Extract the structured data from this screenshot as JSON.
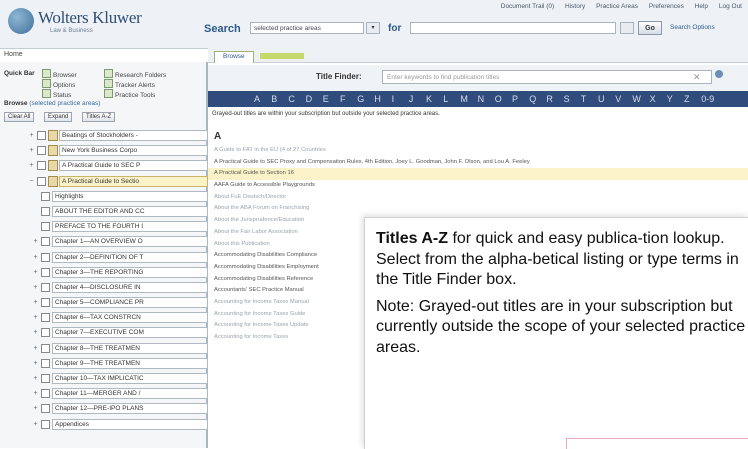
{
  "header": {
    "logo_name": "Wolters Kluwer",
    "logo_sub": "Law & Business",
    "top_links": [
      "Document Trail (0)",
      "History",
      "Practice Areas",
      "Preferences",
      "Help",
      "Log Out"
    ],
    "search_label": "Search",
    "search_scope_value": "selected practice areas",
    "for_label": "for",
    "for_value": "",
    "go_label": "Go",
    "search_options_label": "Search Options"
  },
  "home_link": "Home",
  "quick_bar": {
    "label": "Quick Bar",
    "items": [
      "Browser",
      "Research Folders",
      "Options",
      "Tracker Alerts",
      "Status",
      "Practice Tools"
    ]
  },
  "browse": {
    "label": "Browse",
    "hint": "(selected practice areas)",
    "tools": [
      "Clear All",
      "Expand",
      "Titles A-Z"
    ]
  },
  "tree": [
    {
      "label": "Beatings of Stockholders -",
      "level": 0,
      "expand": "+",
      "selected": false
    },
    {
      "label": "New York Business Corpo",
      "level": 0,
      "expand": "+",
      "selected": false
    },
    {
      "label": "A Practical Guide to SEC P",
      "level": 0,
      "expand": "+",
      "selected": false
    },
    {
      "label": "A Practical Guide to Sectio",
      "level": 0,
      "expand": "−",
      "selected": true
    },
    {
      "label": "Highlights",
      "level": 1,
      "expand": "",
      "selected": false
    },
    {
      "label": "ABOUT THE EDITOR AND CC",
      "level": 1,
      "expand": "",
      "selected": false
    },
    {
      "label": "PREFACE TO THE FOURTH I",
      "level": 1,
      "expand": "",
      "selected": false
    },
    {
      "label": "Chapter 1—AN OVERVIEW O",
      "level": 1,
      "expand": "+",
      "selected": false
    },
    {
      "label": "Chapter 2—DEFINITION OF T",
      "level": 1,
      "expand": "+",
      "selected": false
    },
    {
      "label": "Chapter 3—THE REPORTING",
      "level": 1,
      "expand": "+",
      "selected": false
    },
    {
      "label": "Chapter 4—DISCLOSURE IN",
      "level": 1,
      "expand": "+",
      "selected": false
    },
    {
      "label": "Chapter 5—COMPLIANCE PR",
      "level": 1,
      "expand": "+",
      "selected": false
    },
    {
      "label": "Chapter 6—TAX CONSTRCN",
      "level": 1,
      "expand": "+",
      "selected": false
    },
    {
      "label": "Chapter 7—EXECUTIVE COM",
      "level": 1,
      "expand": "+",
      "selected": false
    },
    {
      "label": "Chapter 8—THE TREATMEN",
      "level": 1,
      "expand": "+",
      "selected": false
    },
    {
      "label": "Chapter 9—THE TREATMEN",
      "level": 1,
      "expand": "+",
      "selected": false
    },
    {
      "label": "Chapter 10—TAX IMPLICATIC",
      "level": 1,
      "expand": "+",
      "selected": false
    },
    {
      "label": "Chapter 11—MERGER AND /",
      "level": 1,
      "expand": "+",
      "selected": false
    },
    {
      "label": "Chapter 12—PRE-IPO PLANS",
      "level": 1,
      "expand": "+",
      "selected": false
    },
    {
      "label": "Appendices",
      "level": 1,
      "expand": "+",
      "selected": false
    }
  ],
  "right": {
    "tab_label": "Browse",
    "title_finder_label": "Title Finder:",
    "title_finder_placeholder": "Enter keywords to find publication titles",
    "alphabet": [
      "A",
      "B",
      "C",
      "D",
      "E",
      "F",
      "G",
      "H",
      "I",
      "J",
      "K",
      "L",
      "M",
      "N",
      "O",
      "P",
      "Q",
      "R",
      "S",
      "T",
      "U",
      "V",
      "W",
      "X",
      "Y",
      "Z",
      "0-9"
    ],
    "notice": "Grayed-out titles are within your subscription but outside your selected practice areas.",
    "section": "A",
    "titles": [
      {
        "text": "A Guide to FAT in the EU (4 of 27 Countries",
        "gray": true,
        "hl": false
      },
      {
        "text": "A Practical Guide to SEC Proxy and Compensation Rules, 4th Edition, Joey L. Goodman, John F. Olson, and Lou A. Feeley",
        "gray": false,
        "hl": false
      },
      {
        "text": "A Practical Guide to Section 16",
        "gray": false,
        "hl": true
      },
      {
        "text": "AAFA Guide to Accessible Playgrounds",
        "gray": false,
        "hl": false
      },
      {
        "text": "About FuE Deutsch/Director",
        "gray": true,
        "hl": false
      },
      {
        "text": "About the ABA Forum on Franchising",
        "gray": true,
        "hl": false
      },
      {
        "text": "About the Jurisprudence/Education",
        "gray": true,
        "hl": false
      },
      {
        "text": "About the Fair Labor Association",
        "gray": true,
        "hl": false
      },
      {
        "text": "About this Publication",
        "gray": true,
        "hl": false
      },
      {
        "text": "Accommodating Disabilities Compliance",
        "gray": false,
        "hl": false
      },
      {
        "text": "Accommodating Disabilities Employment",
        "gray": false,
        "hl": false
      },
      {
        "text": "Accommodating Disabilities Reference",
        "gray": false,
        "hl": false
      },
      {
        "text": "Accountants' SEC Practice Manual",
        "gray": false,
        "hl": false
      },
      {
        "text": "Accounting for Income Taxes Manual",
        "gray": true,
        "hl": false
      },
      {
        "text": "Accounting for Income Taxes Guide",
        "gray": true,
        "hl": false
      },
      {
        "text": "Accounting for Income Taxes Update",
        "gray": true,
        "hl": false
      },
      {
        "text": "Accounting for Income Taxes",
        "gray": true,
        "hl": false
      }
    ]
  },
  "callout": {
    "title": "Titles A-Z",
    "text1": " for quick and easy publica-tion lookup. Select from the alpha-betical listing or type terms in the Title Finder box.",
    "text2": "Note: Grayed-out titles are in your subscription but currently outside the scope of your selected practice areas."
  },
  "colors": {
    "alpha_bar": "#2f4c7c",
    "selected_row": "#fbf3c7",
    "brand_blue": "#2d5a8a"
  }
}
